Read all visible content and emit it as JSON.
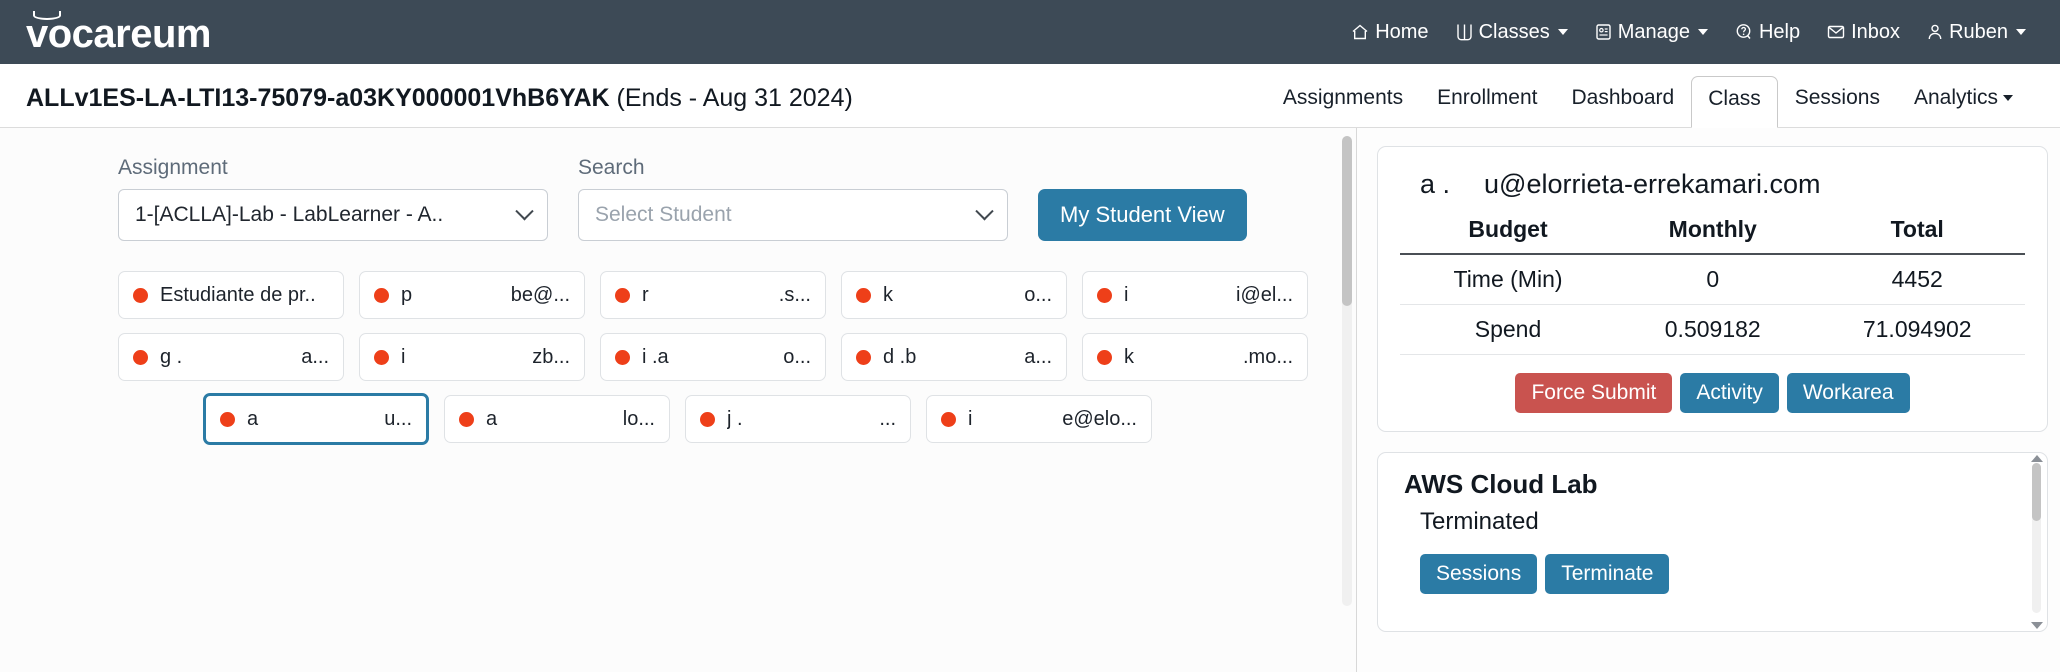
{
  "topbar": {
    "brand": "vocareum",
    "nav": [
      {
        "label": "Home",
        "icon": "home-icon",
        "caret": false
      },
      {
        "label": "Classes",
        "icon": "book-icon",
        "caret": true
      },
      {
        "label": "Manage",
        "icon": "id-card-icon",
        "caret": true
      },
      {
        "label": "Help",
        "icon": "help-icon",
        "caret": false
      },
      {
        "label": "Inbox",
        "icon": "envelope-icon",
        "caret": false
      },
      {
        "label": "Ruben",
        "icon": "user-icon",
        "caret": true
      }
    ]
  },
  "subbar": {
    "course_id": "ALLv1ES-LA-LTI13-75079-a03KY000001VhB6YAK",
    "course_ends": "(Ends - Aug 31 2024)",
    "tabs": [
      {
        "label": "Assignments",
        "active": false,
        "caret": false
      },
      {
        "label": "Enrollment",
        "active": false,
        "caret": false
      },
      {
        "label": "Dashboard",
        "active": false,
        "caret": false
      },
      {
        "label": "Class",
        "active": true,
        "caret": false
      },
      {
        "label": "Sessions",
        "active": false,
        "caret": false
      },
      {
        "label": "Analytics",
        "active": false,
        "caret": true
      }
    ]
  },
  "filters": {
    "assignment_label": "Assignment",
    "assignment_value": "1-[ACLLA]-Lab - LabLearner - A..",
    "search_label": "Search",
    "search_placeholder": "Select Student",
    "student_view_button": "My Student View"
  },
  "students": [
    [
      {
        "name": "Estudiante de pr...",
        "email": "",
        "status_color": "#ee3f19",
        "selected": false
      },
      {
        "name": "p",
        "email": "be@...",
        "status_color": "#ee3f19",
        "selected": false
      },
      {
        "name": "r",
        "email": ".s...",
        "status_color": "#ee3f19",
        "selected": false
      },
      {
        "name": "k",
        "email": "o...",
        "status_color": "#ee3f19",
        "selected": false
      },
      {
        "name": "i",
        "email": "i@el...",
        "status_color": "#ee3f19",
        "selected": false
      }
    ],
    [
      {
        "name": "g            .",
        "email": "a...",
        "status_color": "#ee3f19",
        "selected": false
      },
      {
        "name": "i",
        "email": "zb...",
        "status_color": "#ee3f19",
        "selected": false
      },
      {
        "name": "i         .a",
        "email": "o...",
        "status_color": "#ee3f19",
        "selected": false
      },
      {
        "name": "d      .b",
        "email": "a...",
        "status_color": "#ee3f19",
        "selected": false
      },
      {
        "name": "k",
        "email": ".mo...",
        "status_color": "#ee3f19",
        "selected": false
      }
    ],
    [
      {
        "name": "a",
        "email": "u...",
        "status_color": "#ee3f19",
        "selected": true
      },
      {
        "name": "a",
        "email": "lo...",
        "status_color": "#ee3f19",
        "selected": false
      },
      {
        "name": "j             .",
        "email": "...",
        "status_color": "#ee3f19",
        "selected": false
      },
      {
        "name": "i",
        "email": "e@elo...",
        "status_color": "#ee3f19",
        "selected": false
      }
    ]
  ],
  "detail": {
    "student_name": "a        .",
    "student_email": "u@elorrieta-errekamari.com",
    "table": {
      "headers": [
        "Budget",
        "Monthly",
        "Total"
      ],
      "rows": [
        [
          "Time (Min)",
          "0",
          "4452"
        ],
        [
          "Spend",
          "0.509182",
          "71.094902"
        ]
      ]
    },
    "actions": [
      {
        "label": "Force Submit",
        "style": "danger"
      },
      {
        "label": "Activity",
        "style": "info"
      },
      {
        "label": "Workarea",
        "style": "info"
      }
    ]
  },
  "lab": {
    "title": "AWS Cloud Lab",
    "status": "Terminated",
    "actions": [
      {
        "label": "Sessions",
        "style": "info"
      },
      {
        "label": "Terminate",
        "style": "info"
      }
    ]
  },
  "colors": {
    "navbar": "#3d4a56",
    "primary": "#2b7ba5",
    "danger": "#c9534f",
    "status_dot": "#ee3f19"
  }
}
